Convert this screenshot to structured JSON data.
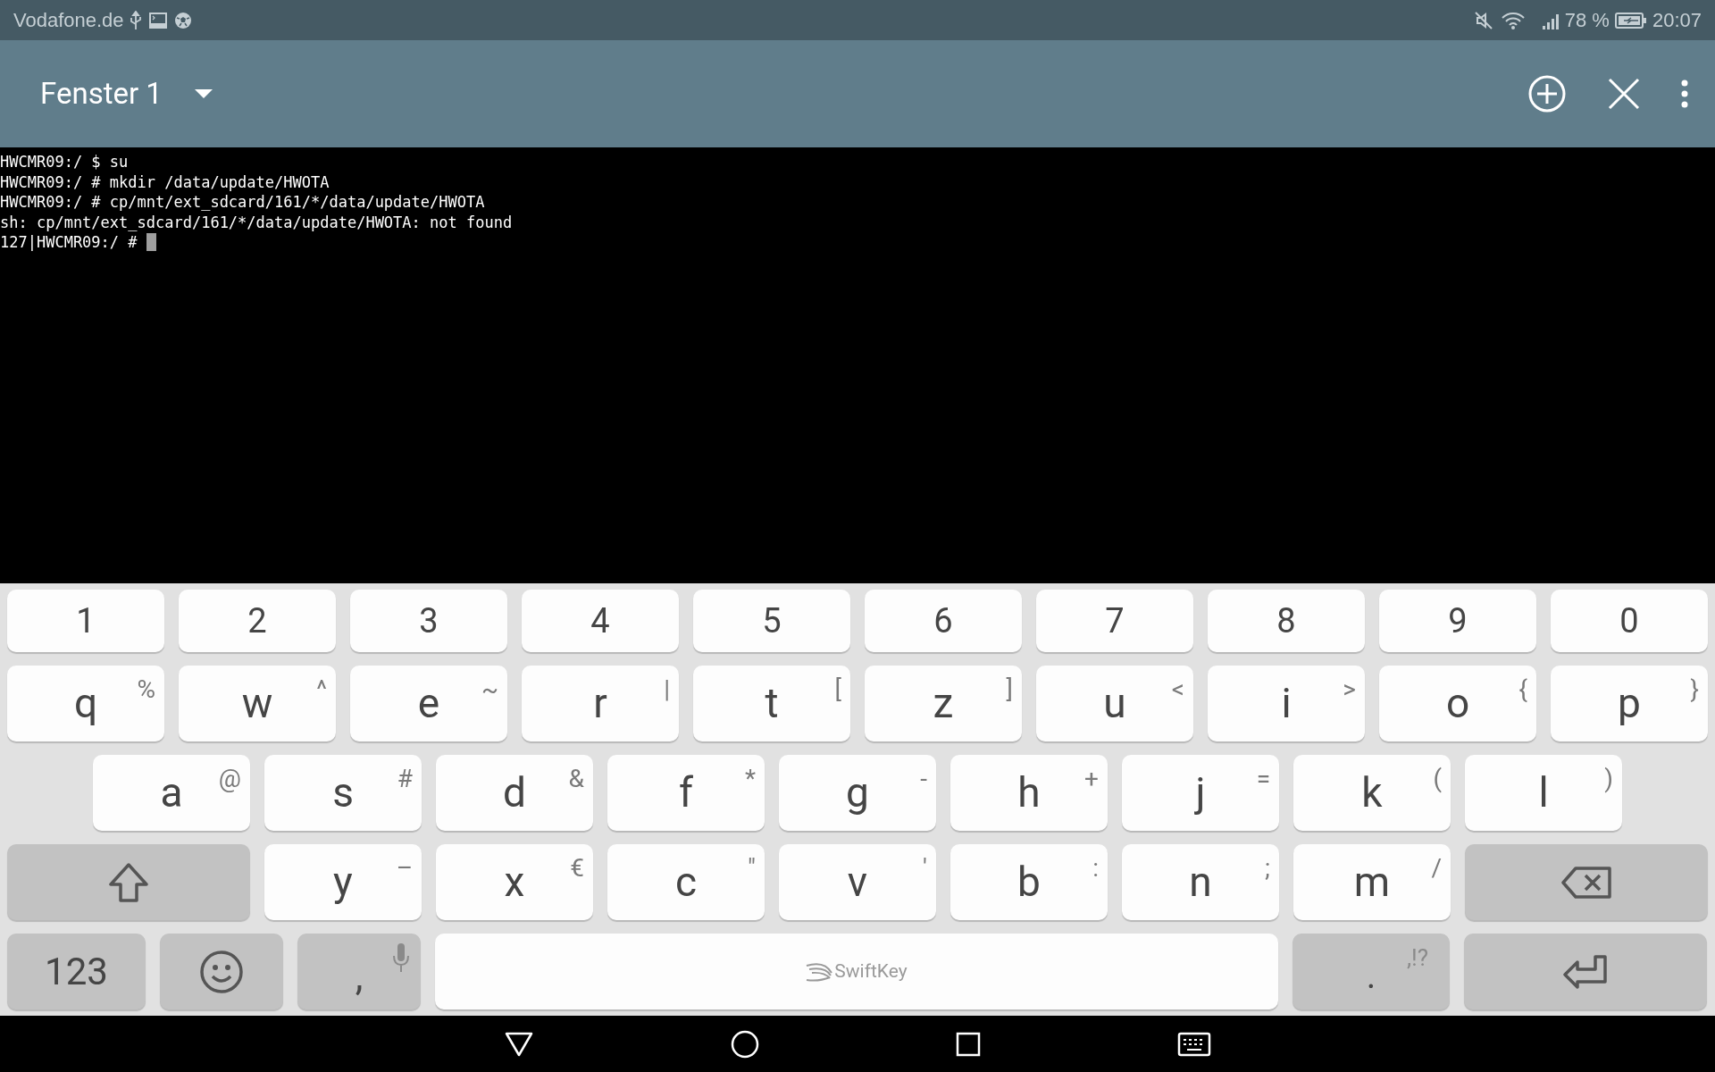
{
  "status_bar": {
    "carrier": "Vodafone.de",
    "battery": "78 %",
    "time": "20:07"
  },
  "toolbar": {
    "title": "Fenster 1"
  },
  "terminal": {
    "lines": [
      "HWCMR09:/ $ su",
      "HWCMR09:/ # mkdir /data/update/HWOTA",
      "HWCMR09:/ # cp/mnt/ext_sdcard/161/*/data/update/HWOTA",
      "sh: cp/mnt/ext_sdcard/161/*/data/update/HWOTA: not found",
      "127|HWCMR09:/ # "
    ]
  },
  "keyboard": {
    "rows": [
      [
        {
          "kind": "digit",
          "label": "1"
        },
        {
          "kind": "digit",
          "label": "2"
        },
        {
          "kind": "digit",
          "label": "3"
        },
        {
          "kind": "digit",
          "label": "4"
        },
        {
          "kind": "digit",
          "label": "5"
        },
        {
          "kind": "digit",
          "label": "6"
        },
        {
          "kind": "digit",
          "label": "7"
        },
        {
          "kind": "digit",
          "label": "8"
        },
        {
          "kind": "digit",
          "label": "9"
        },
        {
          "kind": "digit",
          "label": "0"
        }
      ],
      [
        {
          "kind": "char",
          "label": "q",
          "hint": "%"
        },
        {
          "kind": "char",
          "label": "w",
          "hint": "^"
        },
        {
          "kind": "char",
          "label": "e",
          "hint": "~"
        },
        {
          "kind": "char",
          "label": "r",
          "hint": "|"
        },
        {
          "kind": "char",
          "label": "t",
          "hint": "["
        },
        {
          "kind": "char",
          "label": "z",
          "hint": "]"
        },
        {
          "kind": "char",
          "label": "u",
          "hint": "<"
        },
        {
          "kind": "char",
          "label": "i",
          "hint": ">"
        },
        {
          "kind": "char",
          "label": "o",
          "hint": "{"
        },
        {
          "kind": "char",
          "label": "p",
          "hint": "}"
        }
      ],
      [
        {
          "kind": "char",
          "label": "a",
          "hint": "@"
        },
        {
          "kind": "char",
          "label": "s",
          "hint": "#"
        },
        {
          "kind": "char",
          "label": "d",
          "hint": "&"
        },
        {
          "kind": "char",
          "label": "f",
          "hint": "*"
        },
        {
          "kind": "char",
          "label": "g",
          "hint": "-"
        },
        {
          "kind": "char",
          "label": "h",
          "hint": "+"
        },
        {
          "kind": "char",
          "label": "j",
          "hint": "="
        },
        {
          "kind": "char",
          "label": "k",
          "hint": "("
        },
        {
          "kind": "char",
          "label": "l",
          "hint": ")"
        }
      ],
      [
        {
          "kind": "shift"
        },
        {
          "kind": "char",
          "label": "y",
          "hint": "–"
        },
        {
          "kind": "char",
          "label": "x",
          "hint": "€"
        },
        {
          "kind": "char",
          "label": "c",
          "hint": "\""
        },
        {
          "kind": "char",
          "label": "v",
          "hint": "'"
        },
        {
          "kind": "char",
          "label": "b",
          "hint": ":"
        },
        {
          "kind": "char",
          "label": "n",
          "hint": ";"
        },
        {
          "kind": "char",
          "label": "m",
          "hint": "/"
        },
        {
          "kind": "backspace"
        }
      ],
      [
        {
          "kind": "symbols",
          "label": "123"
        },
        {
          "kind": "emoji"
        },
        {
          "kind": "comma",
          "label": ","
        },
        {
          "kind": "space",
          "label": "SwiftKey"
        },
        {
          "kind": "period",
          "label": ".",
          "hint": ",!?"
        },
        {
          "kind": "enter"
        }
      ]
    ]
  }
}
